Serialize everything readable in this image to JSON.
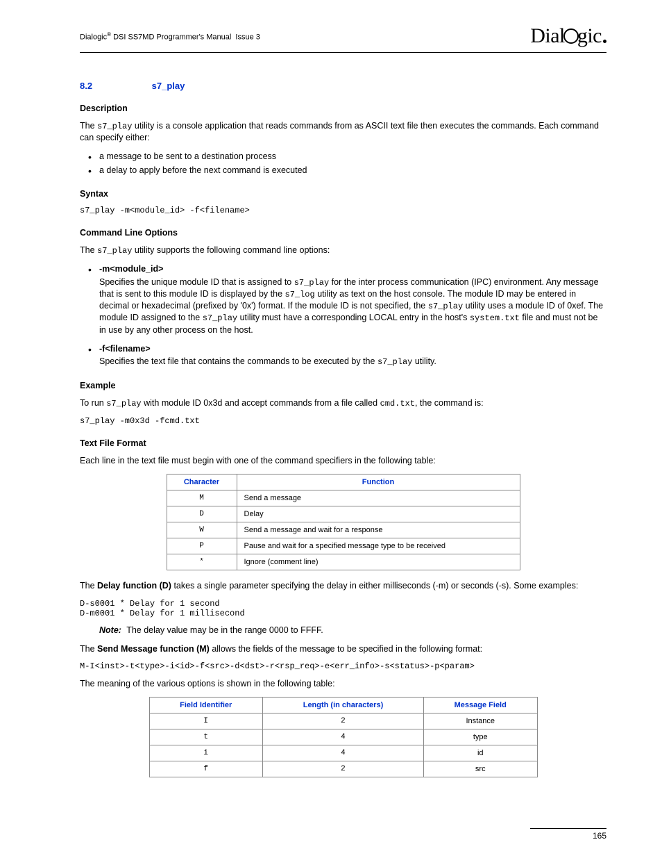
{
  "header": {
    "left": "Dialogic® DSI SS7MD Programmer's Manual  Issue 3",
    "logoText1": "Dial",
    "logoText2": "gic"
  },
  "section": {
    "number": "8.2",
    "title": "s7_play"
  },
  "description": {
    "heading": "Description",
    "p1_a": "The ",
    "p1_b": " utility is a console application that reads commands from as ASCII text file then executes the commands. Each command can specify either:",
    "bullets": [
      "a message to be sent to a destination process",
      "a delay to apply before the next command is executed"
    ]
  },
  "syntax": {
    "heading": "Syntax",
    "code": "s7_play -m<module_id> -f<filename>"
  },
  "options": {
    "heading": "Command Line Options",
    "intro_a": "The ",
    "intro_b": " utility supports the following command line options:",
    "items": [
      {
        "name": "-m<module_id>",
        "desc_a": "Specifies the unique module ID that is assigned to ",
        "desc_b": " for the inter process communication (IPC) environment. Any message that is sent to this module ID is displayed by the ",
        "desc_c": " utility as text on the host console. The module ID may be entered in decimal or hexadecimal (prefixed by '0x') format. If the module ID is not specified, the ",
        "desc_d": " utility uses a module ID of 0xef. The module ID assigned to the ",
        "desc_e": " utility must have a corresponding LOCAL entry in the host's ",
        "desc_f": " file and must not be in use by any other process on the host.",
        "m1": "s7_play",
        "m2": "s7_log",
        "m3": "s7_play",
        "m4": "s7_play",
        "m5": "system.txt"
      },
      {
        "name": "-f<filename>",
        "desc_a": "Specifies the text file that contains the commands to be executed by the ",
        "desc_b": " utility.",
        "m1": "s7_play"
      }
    ]
  },
  "example": {
    "heading": "Example",
    "p_a": "To run ",
    "p_b": " with module ID 0x3d and accept commands from a file called ",
    "p_c": ", the command is:",
    "m1": "s7_play",
    "m2": "cmd.txt",
    "code": "s7_play -m0x3d -fcmd.txt"
  },
  "fileformat": {
    "heading": "Text File Format",
    "intro": "Each line in the text file must begin with one of the command specifiers in the following table:",
    "table1": {
      "headers": [
        "Character",
        "Function"
      ],
      "rows": [
        [
          "M",
          "Send a message"
        ],
        [
          "D",
          "Delay"
        ],
        [
          "W",
          "Send a message and wait for a response"
        ],
        [
          "P",
          "Pause and wait for a specified message type to be received"
        ],
        [
          "*",
          "Ignore (comment line)"
        ]
      ]
    },
    "delay_a": "The ",
    "delay_bold": "Delay function (D)",
    "delay_b": " takes a single parameter specifying the delay in either milliseconds (-m) or seconds (-s). Some examples:",
    "delay_code": "D-s0001 * Delay for 1 second\nD-m0001 * Delay for 1 millisecond",
    "note_label": "Note:",
    "note_text": "The delay value may be in the range 0000 to FFFF.",
    "send_a": "The ",
    "send_bold": "Send Message function (M)",
    "send_b": " allows the fields of the message to be specified in the following format:",
    "send_code": "M-I<inst>-t<type>-i<id>-f<src>-d<dst>-r<rsp_req>-e<err_info>-s<status>-p<param>",
    "send_meaning": "The meaning of the various options is shown in the following table:",
    "table2": {
      "headers": [
        "Field Identifier",
        "Length (in characters)",
        "Message Field"
      ],
      "rows": [
        [
          "I",
          "2",
          "Instance"
        ],
        [
          "t",
          "4",
          "type"
        ],
        [
          "i",
          "4",
          "id"
        ],
        [
          "f",
          "2",
          "src"
        ]
      ]
    }
  },
  "footer": {
    "pageno": "165"
  }
}
